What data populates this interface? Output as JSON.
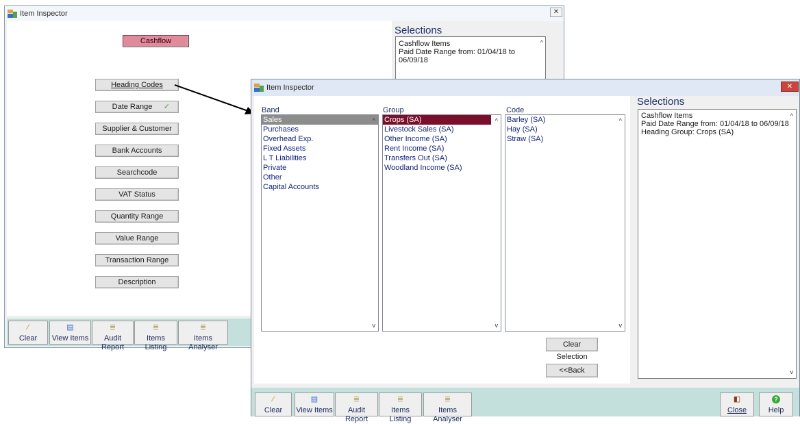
{
  "back_window": {
    "title": "Item Inspector",
    "close": "✕",
    "cashflow": "Cashflow",
    "buttons": [
      "Heading Codes",
      "Date Range",
      "Supplier & Customer",
      "Bank Accounts",
      "Searchcode",
      "VAT Status",
      "Quantity Range",
      "Value Range",
      "Transaction Range",
      "Description"
    ],
    "date_check": "✓",
    "selections_heading": "Selections",
    "selections": [
      "Cashflow Items",
      "Paid Date Range from: 01/04/18 to 06/09/18"
    ],
    "toolbar": [
      "Clear",
      "View Items",
      "Audit Report",
      "Items Listing",
      "Items Analyser"
    ]
  },
  "front_window": {
    "title": "Item Inspector",
    "close": "✕",
    "band_label": "Band",
    "group_label": "Group",
    "code_label": "Code",
    "band_items": [
      "Sales",
      "Purchases",
      "Overhead Exp.",
      "Fixed Assets",
      "L T Liabilities",
      "Private",
      "Other",
      "Capital Accounts"
    ],
    "band_selected": "Sales",
    "group_items": [
      "Crops (SA)",
      "Livestock Sales (SA)",
      "Other Income (SA)",
      "Rent Income (SA)",
      "Transfers Out (SA)",
      "Woodland Income (SA)"
    ],
    "group_selected": "Crops (SA)",
    "code_items": [
      "Barley (SA)",
      "Hay (SA)",
      "Straw (SA)"
    ],
    "selections_heading": "Selections",
    "selections": [
      "Cashflow Items",
      "Paid Date Range from: 01/04/18 to 06/09/18",
      "Heading Group: Crops (SA)"
    ],
    "clear_selection": "Clear Selection",
    "back": "<<Back",
    "toolbar": [
      "Clear",
      "View Items",
      "Audit Report",
      "Items Listing",
      "Items Analyser"
    ],
    "close_label": "Close",
    "help_label": "Help"
  },
  "colors": {
    "toolbar_bg": "#c4e0dc",
    "cashflow_btn": "#e08a9a",
    "group_selected": "#7a0f2c",
    "titlebar_front": "#dfe8f4"
  }
}
